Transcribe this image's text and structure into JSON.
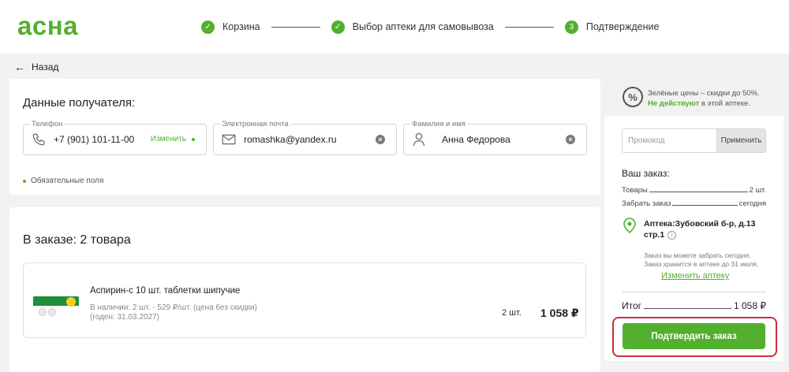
{
  "header": {
    "logo": "асна",
    "steps": [
      {
        "marker": "✓",
        "label": "Корзина"
      },
      {
        "marker": "✓",
        "label": "Выбор аптеки для самовывоза"
      },
      {
        "marker": "3",
        "label": "Подтверждение"
      }
    ]
  },
  "nav": {
    "back_label": "Назад",
    "back_icon": "arrow-left-icon"
  },
  "recipient": {
    "title": "Данные получателя:",
    "phone": {
      "label": "Телефон",
      "value": "+7 (901) 101-11-00",
      "change_label": "Изменить",
      "icon": "phone-icon"
    },
    "email": {
      "label": "Электронная почта",
      "value": "romashka@yandex.ru",
      "icon": "envelope-icon"
    },
    "name": {
      "label": "Фамилия и имя",
      "value": "Анна Федорова",
      "icon": "person-icon"
    },
    "required_note": "Обязательные поля"
  },
  "order": {
    "title": "В заказе: 2 товара",
    "item": {
      "name": "Аспирин-с 10 шт. таблетки шипучие",
      "availability": "В наличии: 2 шт. - 529 ₽/шт. (цена без скидки)",
      "expiry": "(годен: 31.03.2027)",
      "quantity": "2 шт.",
      "price": "1 058 ₽"
    }
  },
  "summary": {
    "promo_banner_line1": "Зелёные цены – скидки до 50%.",
    "promo_banner_emph": "Не действуют",
    "promo_banner_rest": " в этой аптеке.",
    "promo_icon": "percent-icon",
    "promo_placeholder": "Промокод",
    "promo_apply": "Применить",
    "your_order": "Ваш заказ:",
    "goods_label": "Товары",
    "goods_value": "2 шт.",
    "pickup_label": "Забрать заказ",
    "pickup_value": "сегодня",
    "pharmacy": "Аптека:Зубовский б-р, д.13 стр.1",
    "pickup_note_1": "Заказ вы можете забрать сегодня.",
    "pickup_note_2": "Заказ хранится в аптеке до 31 июля.",
    "change_pharmacy": "Изменить аптеку",
    "total_label": "Итог",
    "total_value": "1 058 ₽",
    "confirm": "Подтвердить заказ"
  },
  "colors": {
    "brand": "#53b02e",
    "highlight": "#c3313c"
  }
}
